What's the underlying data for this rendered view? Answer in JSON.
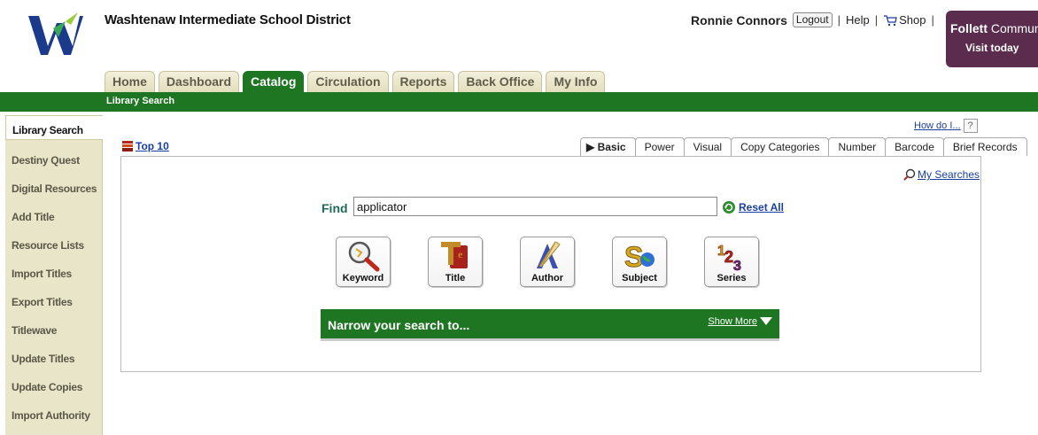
{
  "header": {
    "district": "Washtenaw Intermediate School District",
    "user_name": "Ronnie Connors",
    "logout_label": "Logout",
    "help_label": "Help",
    "shop_label": "Shop",
    "promo_brand": "Follett",
    "promo_rest": "Community",
    "promo_cta": "Visit today"
  },
  "tabs": [
    {
      "label": "Home",
      "active": false
    },
    {
      "label": "Dashboard",
      "active": false
    },
    {
      "label": "Catalog",
      "active": true
    },
    {
      "label": "Circulation",
      "active": false
    },
    {
      "label": "Reports",
      "active": false
    },
    {
      "label": "Back Office",
      "active": false
    },
    {
      "label": "My Info",
      "active": false
    }
  ],
  "subnav_label": "Library Search",
  "sidebar": {
    "items": [
      {
        "label": "Library Search",
        "active": true
      },
      {
        "label": "Destiny Quest"
      },
      {
        "label": "Digital Resources"
      },
      {
        "label": "Add Title"
      },
      {
        "label": "Resource Lists"
      },
      {
        "label": "Import Titles"
      },
      {
        "label": "Export Titles"
      },
      {
        "label": "Titlewave"
      },
      {
        "label": "Update Titles"
      },
      {
        "label": "Update Copies"
      },
      {
        "label": "Import Authority"
      }
    ]
  },
  "main": {
    "howdo_label": "How do I...",
    "help_q": "?",
    "top10_label": "Top 10",
    "search_tabs": [
      {
        "label": "Basic",
        "active": true
      },
      {
        "label": "Power"
      },
      {
        "label": "Visual"
      },
      {
        "label": "Copy Categories"
      },
      {
        "label": "Number"
      },
      {
        "label": "Barcode"
      },
      {
        "label": "Brief Records"
      }
    ],
    "my_searches_label": "My Searches",
    "find_label": "Find",
    "find_value": "applicator",
    "reset_label": "Reset All",
    "search_buttons": [
      {
        "label": "Keyword",
        "icon": "magnifier-icon"
      },
      {
        "label": "Title",
        "icon": "title-book-icon"
      },
      {
        "label": "Author",
        "icon": "quill-icon"
      },
      {
        "label": "Subject",
        "icon": "subject-globe-icon"
      },
      {
        "label": "Series",
        "icon": "series-123-icon"
      }
    ],
    "narrow_title": "Narrow your search to...",
    "show_more_label": "Show More"
  },
  "colors": {
    "brand_green": "#1e7622",
    "link_blue": "#1a3fa0",
    "sidebar_bg": "#e9e5c8",
    "promo_purple": "#5b2c4d"
  }
}
